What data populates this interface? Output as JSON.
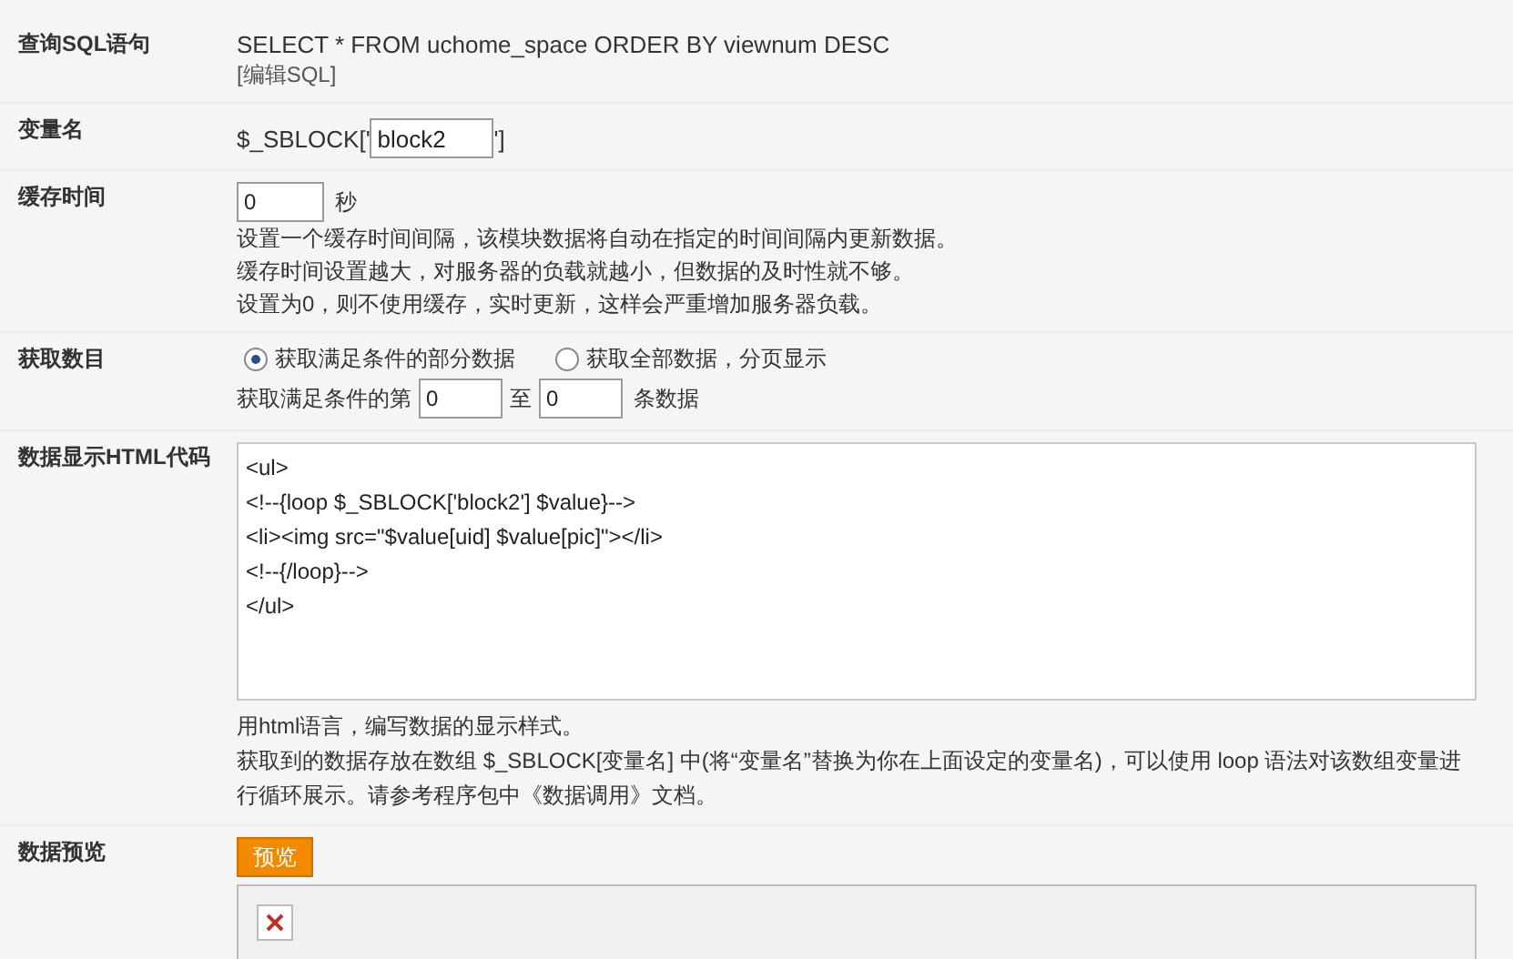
{
  "sql": {
    "label": "查询SQL语句",
    "query": "SELECT * FROM uchome_space ORDER BY viewnum DESC",
    "edit_link": "[编辑SQL]"
  },
  "variable": {
    "label": "变量名",
    "prefix": "$_SBLOCK['",
    "value": "block2",
    "suffix": "']"
  },
  "cache": {
    "label": "缓存时间",
    "value": "0",
    "unit": "秒",
    "help": [
      "设置一个缓存时间间隔，该模块数据将自动在指定的时间间隔内更新数据。",
      "缓存时间设置越大，对服务器的负载就越小，但数据的及时性就不够。",
      "设置为0，则不使用缓存，实时更新，这样会严重增加服务器负载。"
    ]
  },
  "count": {
    "label": "获取数目",
    "options": [
      {
        "label": "获取满足条件的部分数据",
        "selected": true
      },
      {
        "label": "获取全部数据，分页显示",
        "selected": false
      }
    ],
    "range": {
      "prefix": "获取满足条件的第",
      "from": "0",
      "middle": "至",
      "to": "0",
      "suffix": "条数据"
    }
  },
  "html": {
    "label": "数据显示HTML代码",
    "code": "<ul>\n<!--{loop $_SBLOCK['block2'] $value}-->\n<li><img src=\"$value[uid] $value[pic]\"></li>\n<!--{/loop}-->\n</ul>",
    "help": [
      "用html语言，编写数据的显示样式。",
      "获取到的数据存放在数组 $_SBLOCK[变量名] 中(将“变量名”替换为你在上面设定的变量名)，可以使用 loop 语法对该数组变量进行循环展示。请参考程序包中《数据调用》文档。"
    ]
  },
  "preview": {
    "label": "数据预览",
    "button": "预览"
  }
}
